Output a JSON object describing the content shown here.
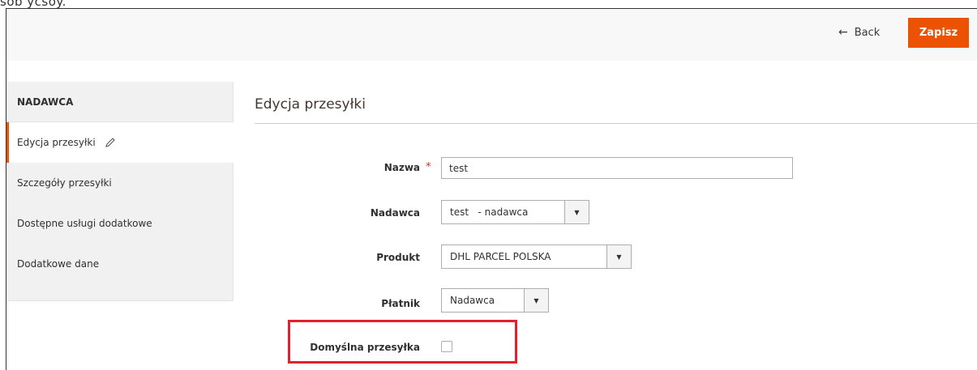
{
  "header": {
    "back_label": "Back",
    "save_label": "Zapisz"
  },
  "top_fragment": "sob ycsoy.",
  "sidebar": {
    "title": "NADAWCA",
    "items": [
      {
        "label": "Edycja przesyłki",
        "active": true
      },
      {
        "label": "Szczegóły przesyłki",
        "active": false
      },
      {
        "label": "Dostępne usługi dodatkowe",
        "active": false
      },
      {
        "label": "Dodatkowe dane",
        "active": false
      }
    ]
  },
  "main": {
    "section_title": "Edycja przesyłki",
    "form": {
      "name": {
        "label": "Nazwa",
        "value": "test",
        "required_mark": "*"
      },
      "sender": {
        "label": "Nadawca",
        "value": "test   - nadawca"
      },
      "product": {
        "label": "Produkt",
        "value": "DHL PARCEL POLSKA"
      },
      "payer": {
        "label": "Płatnik",
        "value": "Nadawca"
      },
      "default_shipment": {
        "label": "Domyślna przesyłka",
        "checked": false
      }
    }
  },
  "colors": {
    "accent": "#eb5202",
    "highlight": "#e3202c",
    "required": "#e22626"
  }
}
